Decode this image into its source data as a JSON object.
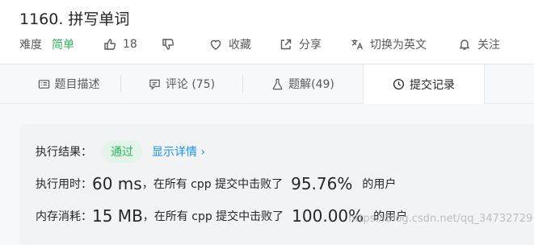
{
  "problem": {
    "title": "1160. 拼写单词",
    "difficulty_label": "难度",
    "difficulty": "简单",
    "likes": "18",
    "actions": {
      "collect": "收藏",
      "share": "分享",
      "switch_lang": "切换为英文",
      "follow": "关注"
    }
  },
  "tabs": [
    {
      "label": "题目描述",
      "icon": "description-icon"
    },
    {
      "label": "评论 (75)",
      "icon": "comment-icon"
    },
    {
      "label": "题解(49)",
      "icon": "flask-icon"
    },
    {
      "label": "提交记录",
      "icon": "clock-icon"
    }
  ],
  "result": {
    "status_label": "执行结果：",
    "status": "通过",
    "details_link": "显示详情 ›",
    "runtime_label": "执行用时：",
    "runtime": "60 ms",
    "runtime_mid": "，在所有 cpp 提交中击败了",
    "runtime_pct": "95.76%",
    "runtime_tail": "的用户",
    "memory_label": "内存消耗：",
    "memory": "15 MB",
    "memory_mid": "，在所有 cpp 提交中击败了",
    "memory_pct": "100.00%",
    "memory_tail": "的用户"
  },
  "watermark": "https://blog.csdn.net/qq_34732729",
  "colors": {
    "easy": "#2db55d",
    "link": "#1890ff",
    "pill_bg": "#e3f4e8"
  }
}
